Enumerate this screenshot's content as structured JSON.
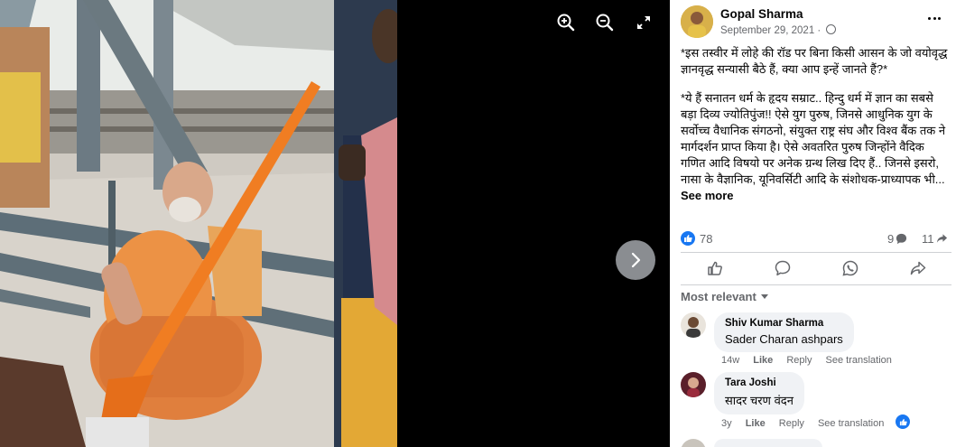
{
  "viewer": {
    "zoom_in_icon": "zoom-in-icon",
    "zoom_out_icon": "zoom-out-icon",
    "fullscreen_icon": "expand-icon",
    "next_icon": "chevron-right-icon"
  },
  "post": {
    "author": "Gopal Sharma",
    "date": "September 29, 2021 · ",
    "paragraph1": "*इस तस्वीर में लोहे की रॉड पर बिना किसी आसन के जो वयोवृद्ध ज्ञानवृद्ध सन्यासी बैठे हैं, क्या आप इन्हें जानते हैं?*",
    "paragraph2": "*ये हैं सनातन धर्म के हृदय सम्राट.. हिन्दु धर्म में ज्ञान का सबसे बड़ा दिव्य ज्योतिपुंज!! ऐसे युग पुरुष, जिनसे आधुनिक युग के सर्वोच्च वैधानिक संगठनो, संयुक्त राष्ट्र संघ और विश्व बैंक तक ने मार्गदर्शन प्राप्त किया है। ऐसे अवतरित पुरुष जिन्होंने वैदिक गणित आदि विषयो पर अनेक ग्रन्थ लिख दिए हैं.. जिनसे इसरो, नासा के वैज्ञानिक, यूनिवर्सिटी आदि के संशोधक-प्राध्यापक भी...",
    "see_more": "See more",
    "reaction_count": "78",
    "comment_count": "9",
    "share_count": "11",
    "accent": "#1877f2"
  },
  "actions": {
    "like_icon": "thumbs-up-icon",
    "comment_icon": "comment-icon",
    "whatsapp_icon": "whatsapp-icon",
    "share_icon": "share-icon"
  },
  "comments": {
    "sort_label": "Most relevant",
    "items": [
      {
        "name": "Shiv Kumar Sharma",
        "text": "Sader Charan ashpars",
        "age": "14w",
        "like": "Like",
        "reply": "Reply",
        "see_translation": "See translation"
      },
      {
        "name": "Tara Joshi",
        "text": "सादर चरण वंदन",
        "age": "3y",
        "like": "Like",
        "reply": "Reply",
        "see_translation": "See translation"
      }
    ]
  }
}
